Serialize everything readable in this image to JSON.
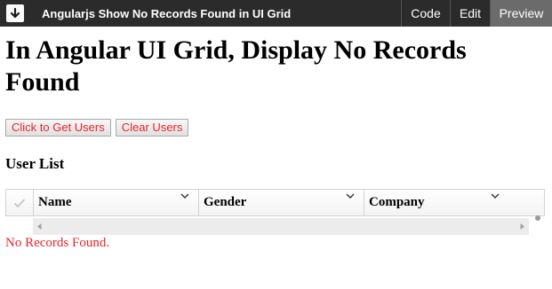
{
  "topbar": {
    "title": "Angularjs Show No Records Found in UI Grid",
    "tabs": [
      {
        "label": "Code"
      },
      {
        "label": "Edit"
      },
      {
        "label": "Preview"
      }
    ]
  },
  "page": {
    "title": "In Angular UI Grid, Display No Records Found",
    "buttons": {
      "get_users": "Click to Get Users",
      "clear_users": "Clear Users"
    },
    "section_title": "User List",
    "empty_message": "No Records Found."
  },
  "grid": {
    "columns": [
      {
        "label": "Name"
      },
      {
        "label": "Gender"
      },
      {
        "label": "Company"
      }
    ]
  },
  "colors": {
    "topbar_bg": "#2b2b2b",
    "active_tab_bg": "#6b6b6b",
    "accent_red": "#e8252c"
  }
}
